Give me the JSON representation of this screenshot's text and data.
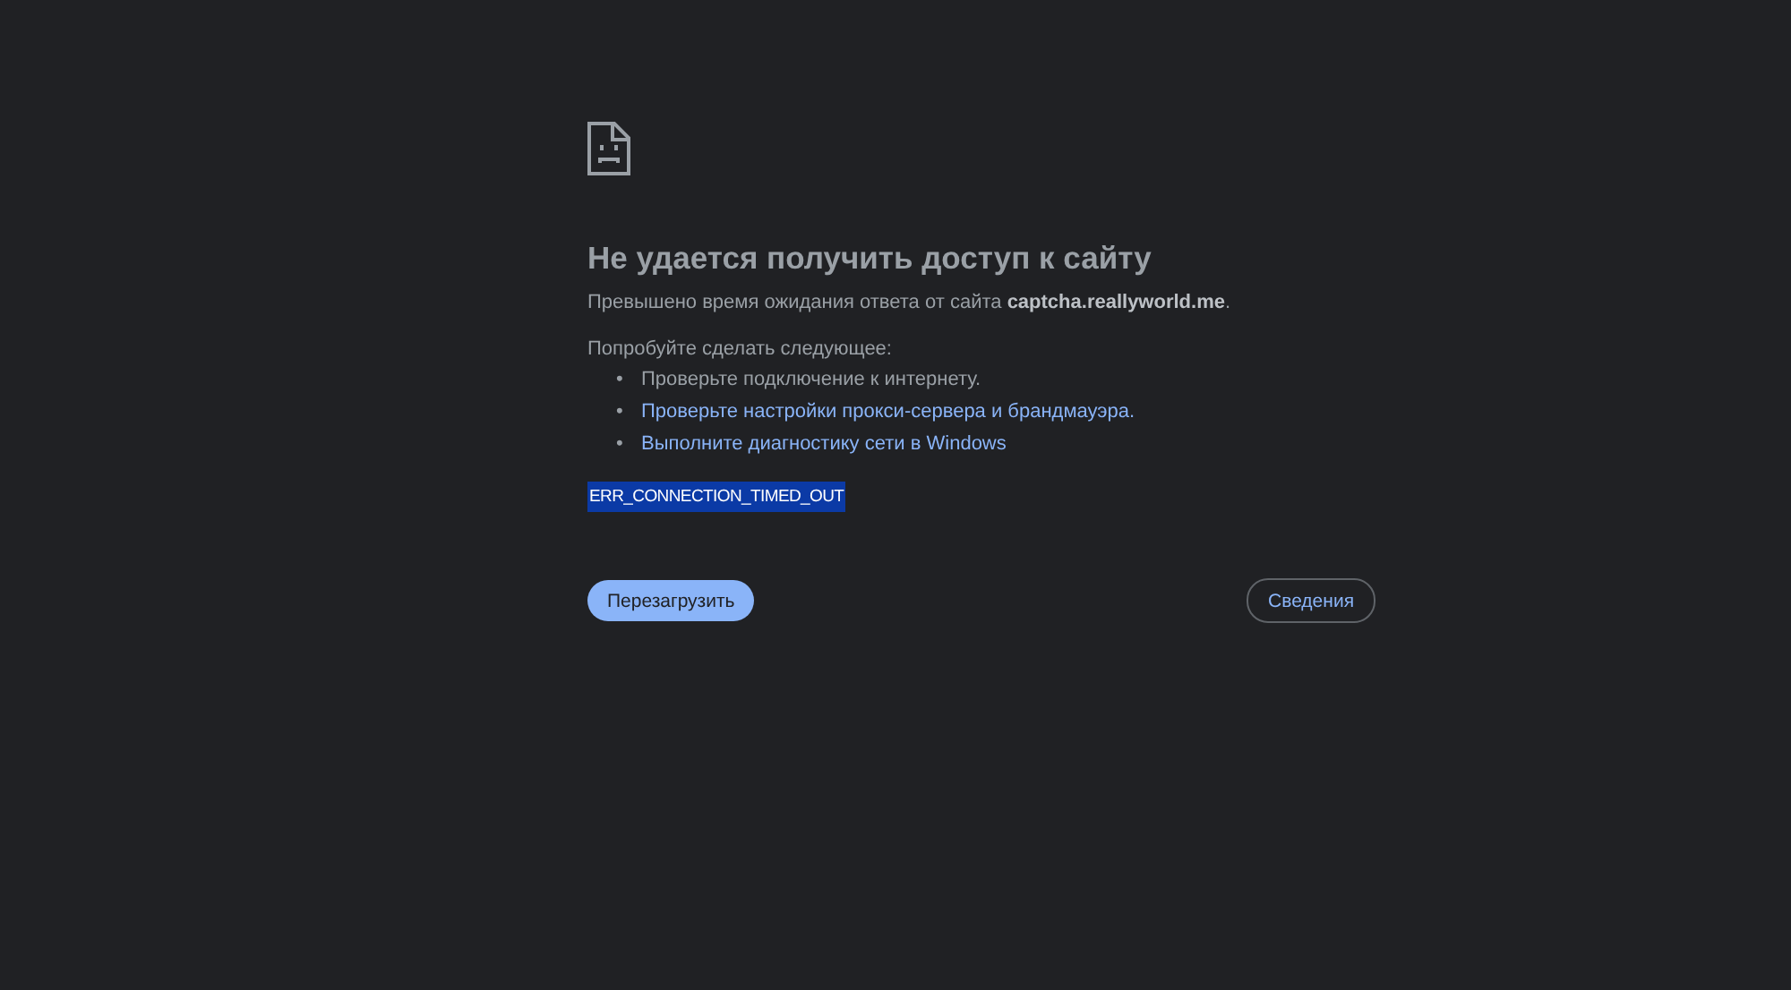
{
  "error_page": {
    "title": "Не удается получить доступ к сайту",
    "message": "Превышено время ожидания ответа от сайта **captcha.reallyworld.me**.",
    "suggestions_intro": "Попробуйте сделать следующее:",
    "suggestions": [
      {
        "kind": "text",
        "bullet": "•",
        "text": "Проверьте подключение к интернету."
      },
      {
        "kind": "link",
        "bullet": "•",
        "text": "Проверьте настройки прокси-сервера и брандмауэра."
      },
      {
        "kind": "link",
        "bullet": "•",
        "text": "Выполните диагностику сети в Windows"
      }
    ],
    "error_code": {
      "text": "ERR_CONNECTION_TIMED_OUT",
      "highlighted": true
    },
    "buttons": [
      {
        "kind": "primary",
        "label": "Перезагрузить"
      },
      {
        "kind": "secondary",
        "label": "Сведения"
      }
    ]
  }
}
